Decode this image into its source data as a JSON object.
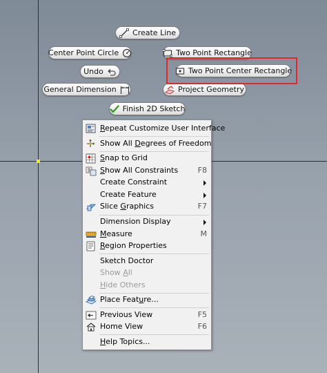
{
  "canvas": {
    "colors": {
      "axis": "#2a2f36",
      "origin_marker": "#f2f200",
      "highlight": "#e8262a"
    }
  },
  "marking_menu": {
    "create_line": {
      "label": "Create Line",
      "icon": "line-icon"
    },
    "center_point_circle": {
      "label": "Center Point Circle",
      "icon": "circle-icon"
    },
    "two_point_rectangle": {
      "label": "Two Point Rectangle",
      "icon": "rectangle-icon"
    },
    "undo": {
      "label": "Undo",
      "icon": "undo-icon"
    },
    "two_point_center_rectangle": {
      "label": "Two Point Center Rectangle",
      "icon": "center-rectangle-icon"
    },
    "general_dimension": {
      "label": "General Dimension",
      "icon": "dimension-icon"
    },
    "project_geometry": {
      "label": "Project Geometry",
      "icon": "project-geometry-icon"
    },
    "finish_2d_sketch": {
      "label": "Finish 2D Sketch",
      "icon": "checkmark-icon"
    }
  },
  "context_menu": {
    "repeat": {
      "prefix": "",
      "u": "R",
      "rest": "epeat Customize User Interface"
    },
    "show_all_dof": {
      "prefix": "Show All ",
      "u": "D",
      "rest": "egrees of Freedom"
    },
    "snap_to_grid": {
      "prefix": "",
      "u": "S",
      "rest": "nap to Grid"
    },
    "show_all_constraints": {
      "prefix": "",
      "u": "S",
      "rest": "how All Constraints",
      "shortcut": "F8"
    },
    "create_constraint": {
      "label": "Create Constraint"
    },
    "create_feature": {
      "label": "Create Feature"
    },
    "slice_graphics": {
      "prefix": "Slice ",
      "u": "G",
      "rest": "raphics",
      "shortcut": "F7"
    },
    "dimension_display": {
      "label": "Dimension Display"
    },
    "measure": {
      "prefix": "",
      "u": "M",
      "rest": "easure",
      "shortcut": "M"
    },
    "region_properties": {
      "prefix": "",
      "u": "R",
      "rest": "egion Properties"
    },
    "sketch_doctor": {
      "label": "Sketch Doctor"
    },
    "show_all": {
      "prefix": "Show ",
      "u": "A",
      "rest": "ll"
    },
    "hide_others": {
      "prefix": "",
      "u": "H",
      "rest": "ide Others"
    },
    "place_feature": {
      "prefix": "Place Feat",
      "u": "u",
      "rest": "re..."
    },
    "previous_view": {
      "label": "Previous View",
      "shortcut": "F5"
    },
    "home_view": {
      "label": "Home View",
      "shortcut": "F6"
    },
    "help_topics": {
      "prefix": "",
      "u": "H",
      "rest": "elp Topics..."
    }
  }
}
